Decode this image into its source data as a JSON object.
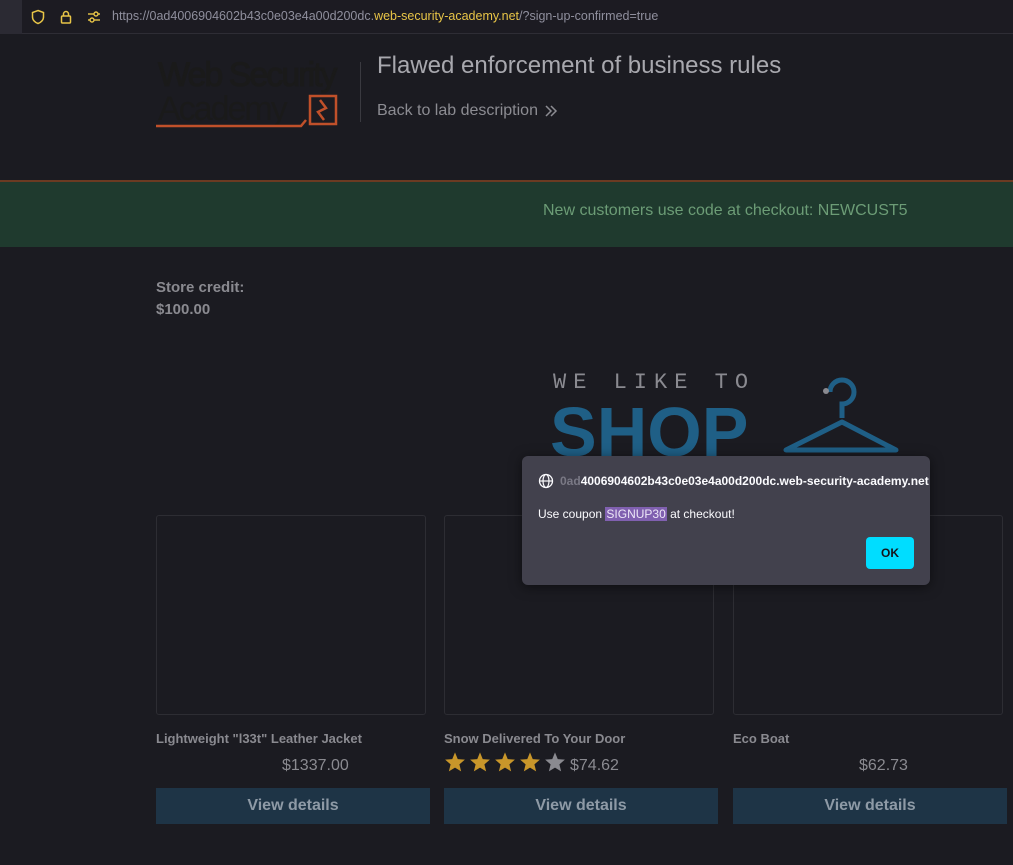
{
  "browser": {
    "url_prefix": "https://0ad4006904602b43c0e03e4a00d200dc.",
    "url_domain": "web-security-academy.net",
    "url_suffix": "/?sign-up-confirmed=true"
  },
  "header": {
    "lab_title": "Flawed enforcement of business rules",
    "back_link": "Back to lab description"
  },
  "banner": {
    "text": "New customers use code at checkout: NEWCUST5"
  },
  "store": {
    "credit_label": "Store credit:",
    "credit_value": "$100.00"
  },
  "shop_banner": {
    "line1": "WE LIKE TO",
    "line2": "SHOP"
  },
  "products": [
    {
      "name": "Lightweight \"l33t\" Leather Jacket",
      "price": "$1337.00",
      "button": "View details"
    },
    {
      "name": "Snow Delivered To Your Door",
      "price": "$74.62",
      "button": "View details",
      "rating": 4
    },
    {
      "name": "Eco Boat",
      "price": "$62.73",
      "button": "View details"
    }
  ],
  "dialog": {
    "origin_faded": "0ad",
    "origin_rest": "4006904602b43c0e03e4a00d200dc.web-security-academy.net",
    "msg_before": "Use coupon ",
    "msg_coupon": "SIGNUP30",
    "msg_after": " at checkout!",
    "ok_label": "OK"
  },
  "colors": {
    "accent_ok": "#00ddff",
    "banner_bg": "#1f3a2e",
    "button_bg": "#1e3446",
    "star": "#c8962a"
  }
}
